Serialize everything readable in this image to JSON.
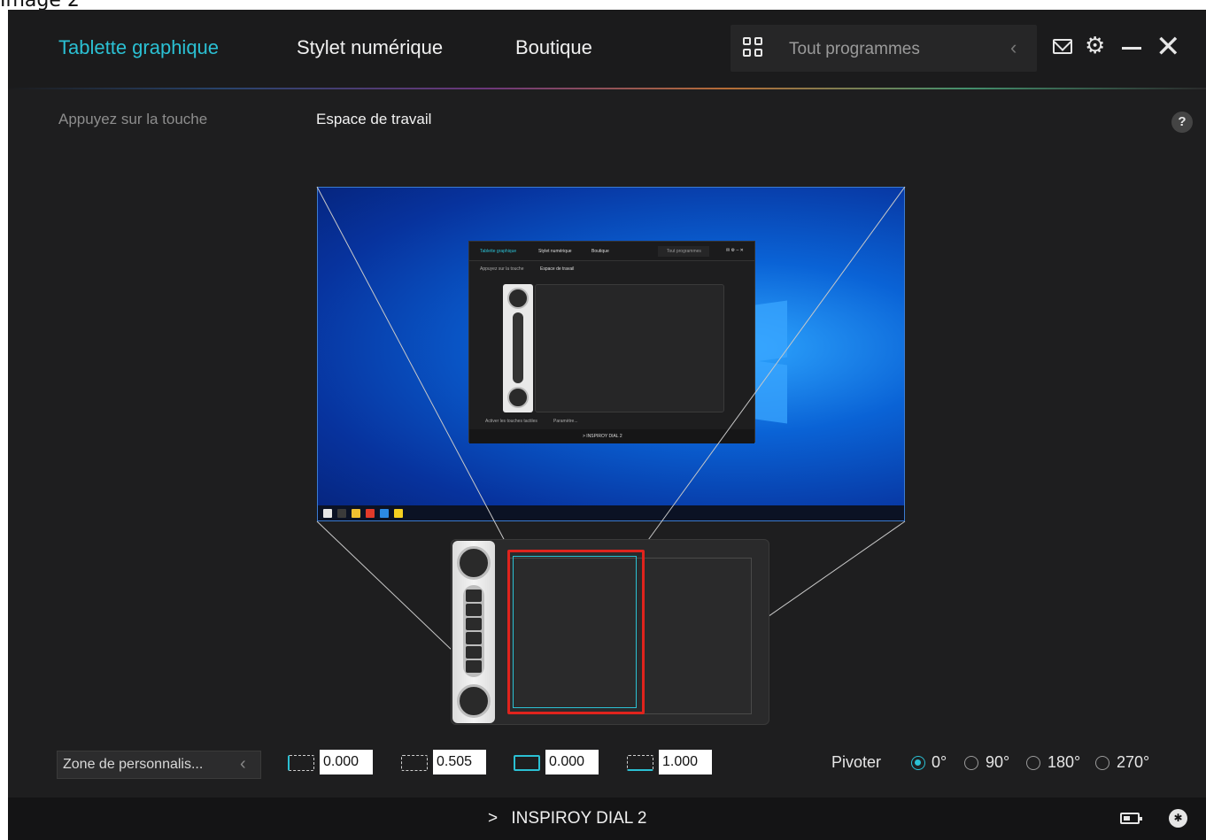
{
  "caption": "Image 2",
  "topbar": {
    "tabs": [
      {
        "label": "Tablette graphique",
        "active": true
      },
      {
        "label": "Stylet numérique",
        "active": false
      },
      {
        "label": "Boutique",
        "active": false
      }
    ],
    "program_selector": {
      "label": "Tout programmes",
      "icon": "grid-icon",
      "arrow_icon": "chevron-left-icon"
    },
    "window_controls": [
      "mail-icon",
      "gear-icon",
      "minimize-icon",
      "close-icon"
    ]
  },
  "subtabs": {
    "items": [
      {
        "label": "Appuyez sur la touche",
        "active": false
      },
      {
        "label": "Espace de travail",
        "active": true
      }
    ],
    "help_label": "?"
  },
  "preview": {
    "mini_app": {
      "tabs": [
        "Tablette graphique",
        "Stylet numérique",
        "Boutique"
      ],
      "program_label": "Tout programmes",
      "subtabs": [
        "Appuyez sur la touche",
        "Espace de travail"
      ],
      "footer_label": "> INSPIROY DIAL 2",
      "checkbox_label": "Activer les touches tactiles",
      "settings_label": "Paramètre..."
    }
  },
  "mapping": {
    "zone_label": "Zone de personnalis...",
    "values": [
      "0.000",
      "0.505",
      "0.000",
      "1.000"
    ],
    "rotate_label": "Pivoter",
    "rotations": [
      {
        "label": "0°",
        "selected": true
      },
      {
        "label": "90°",
        "selected": false
      },
      {
        "label": "180°",
        "selected": false
      },
      {
        "label": "270°",
        "selected": false
      }
    ]
  },
  "footer": {
    "device_label": "INSPIROY DIAL 2",
    "chevron": ">"
  },
  "colors": {
    "accent": "#2bc0d3",
    "active_area": "#e0231d",
    "background": "#1e1e1f"
  }
}
